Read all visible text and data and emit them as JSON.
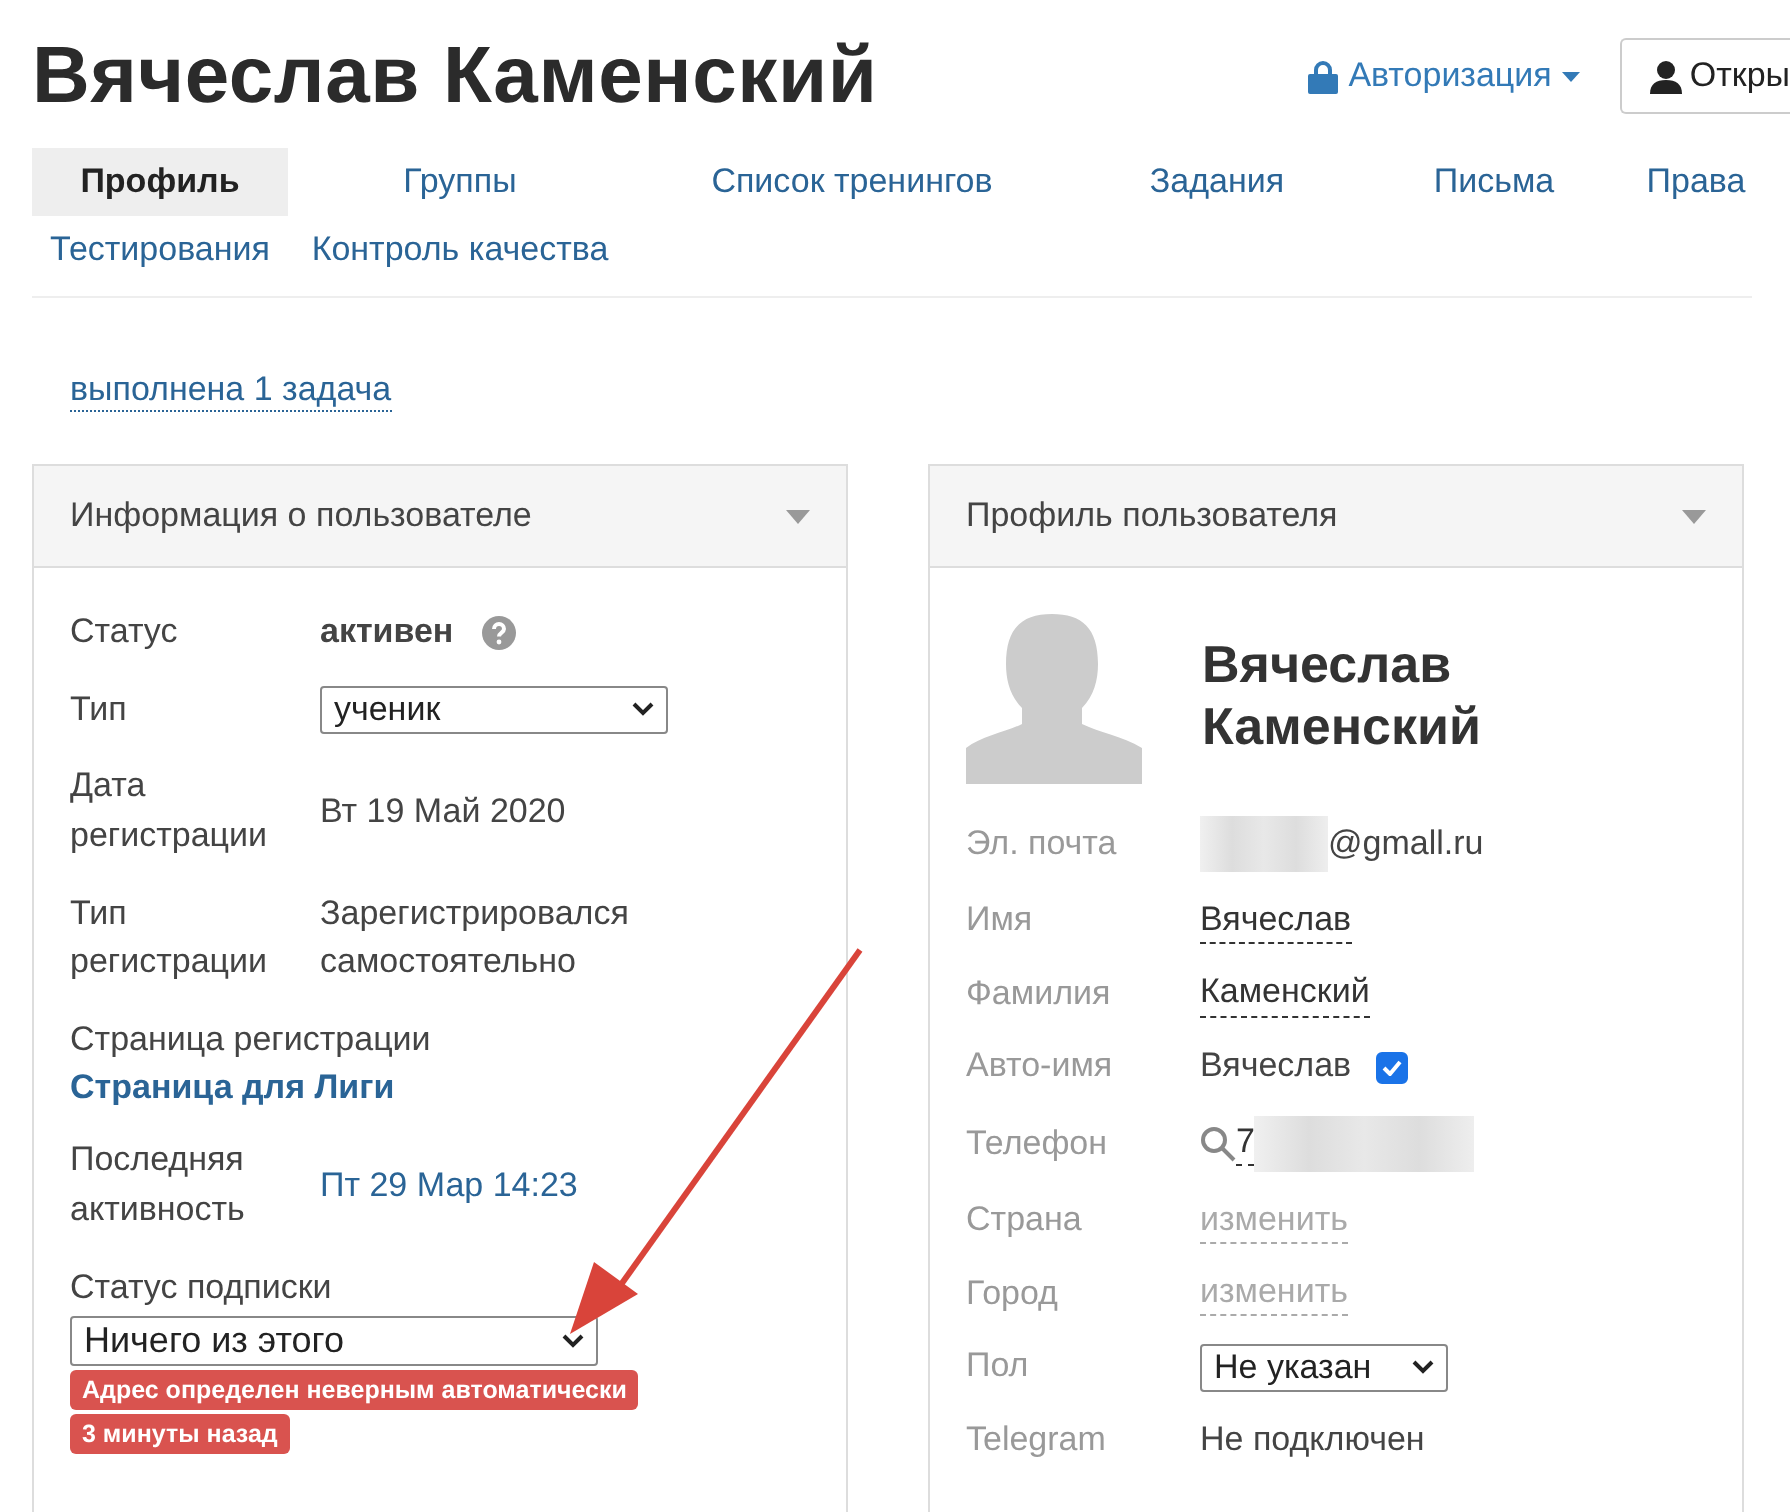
{
  "header": {
    "title": "Вячеслав Каменский",
    "auth_menu": "Авторизация",
    "open_button": "Откры"
  },
  "tabs": [
    {
      "label": "Профиль",
      "selected": true
    },
    {
      "label": "Группы",
      "selected": false
    },
    {
      "label": "Список тренингов",
      "selected": false
    },
    {
      "label": "Задания",
      "selected": false
    },
    {
      "label": "Письма",
      "selected": false
    },
    {
      "label": "Права",
      "selected": false
    },
    {
      "label": "Тестирования",
      "selected": false
    },
    {
      "label": "Контроль качества",
      "selected": false
    }
  ],
  "task_link": "выполнена 1 задача",
  "user_info": {
    "title": "Информация о пользователе",
    "fields": [
      {
        "kind": "status",
        "label": "Статус",
        "value": "активен"
      },
      {
        "kind": "select",
        "label": "Тип",
        "value": "ученик"
      },
      {
        "kind": "text",
        "label": "Дата регистрации",
        "value": "Вт 19 Май 2020"
      },
      {
        "kind": "text",
        "label": "Тип регистрации",
        "value": "Зарегистрировался самостоятельно"
      },
      {
        "kind": "stacked-link",
        "label": "Страница регистрации",
        "value": "Страница для Лиги"
      },
      {
        "kind": "date",
        "label": "Последняя активность",
        "value": "Пт 29 Мар 14:23"
      },
      {
        "kind": "stacked-select",
        "label": "Статус подписки",
        "value": "Ничего из этого",
        "badges": [
          "Адрес определен неверным автоматически",
          "3 минуты назад"
        ]
      }
    ]
  },
  "user_profile": {
    "title": "Профиль пользователя",
    "name": "Вячеслав Каменский",
    "fields": [
      {
        "kind": "email",
        "label": "Эл. почта",
        "value": "@gmall.ru"
      },
      {
        "kind": "editable",
        "label": "Имя",
        "value": "Вячеслав"
      },
      {
        "kind": "editable",
        "label": "Фамилия",
        "value": "Каменский"
      },
      {
        "kind": "checkbox",
        "label": "Авто-имя",
        "value": "Вячеслав",
        "checked": true
      },
      {
        "kind": "phone",
        "label": "Телефон",
        "value": "7"
      },
      {
        "kind": "muted-link",
        "label": "Страна",
        "value": "изменить"
      },
      {
        "kind": "muted-link",
        "label": "Город",
        "value": "изменить"
      },
      {
        "kind": "select",
        "label": "Пол",
        "value": "Не указан"
      },
      {
        "kind": "text",
        "label": "Telegram",
        "value": "Не подключен"
      }
    ]
  }
}
